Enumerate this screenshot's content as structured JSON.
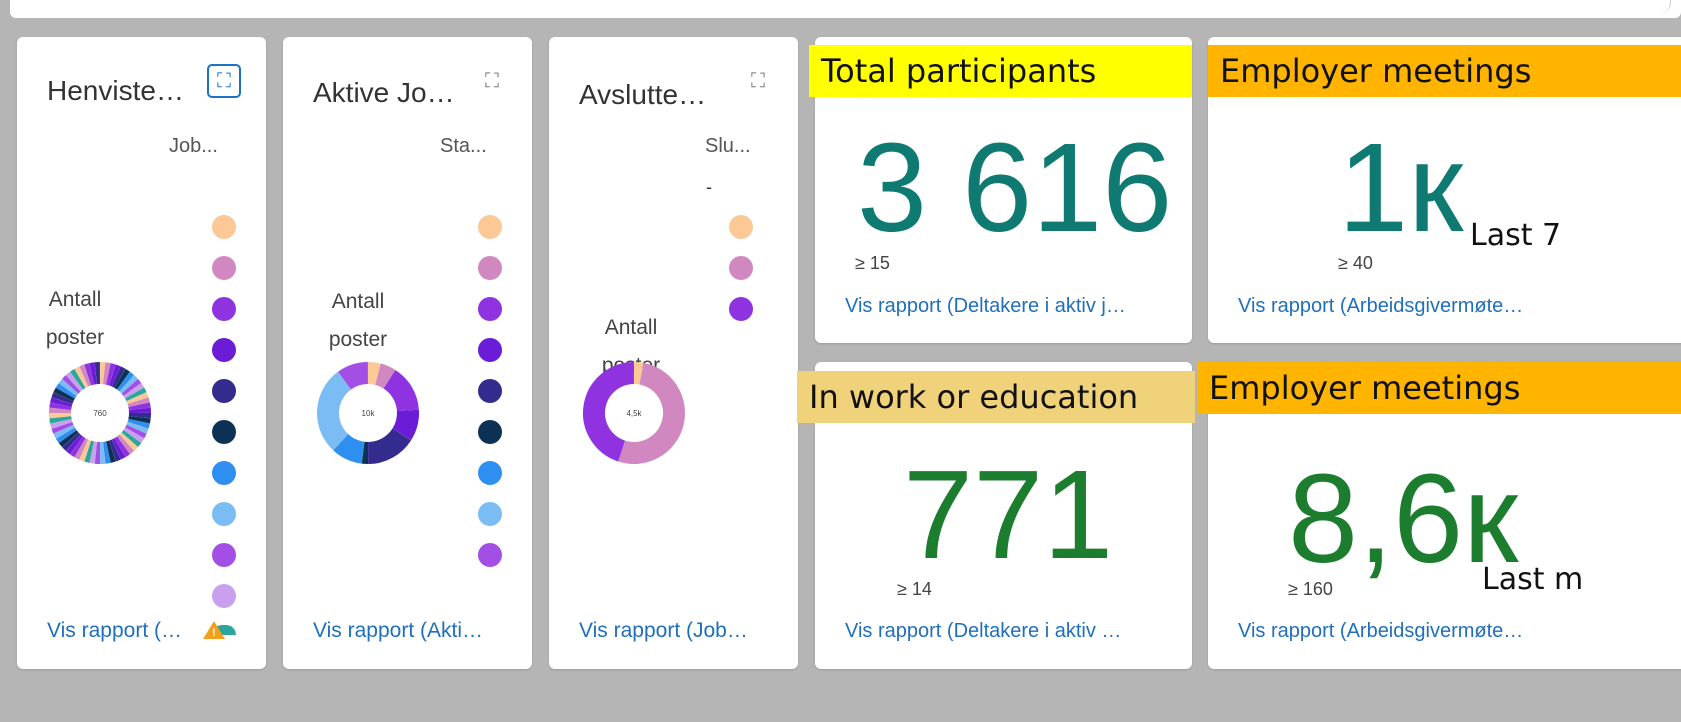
{
  "colors": {
    "kpi_teal": "#0f7a72",
    "kpi_green": "#1d7d2e",
    "link_blue": "#1f6fbf",
    "tag_yellow": "#ffff00",
    "tag_orange": "#ffb400",
    "tag_khaki": "#f0d27a",
    "warning": "#f2a01e"
  },
  "donut_cards": [
    {
      "title": "Henviste…",
      "legend_header": "Job...",
      "center_label_line1": "Antall",
      "center_label_line2": "poster",
      "donut_value": "760",
      "link": "Vis rapport (…",
      "expand_icon": "expand-icon",
      "has_warning": true,
      "legend_colors": [
        "#fbc896",
        "#d187c0",
        "#8f33e0",
        "#6a1cd6",
        "#332b8e",
        "#0d3154",
        "#2e8ff0",
        "#7bbcf5",
        "#a34fe5",
        "#c9a0ee",
        "#2aa69a"
      ]
    },
    {
      "title": "Aktive Jo…",
      "legend_header": "Sta...",
      "center_label_line1": "Antall",
      "center_label_line2": "poster",
      "donut_value": "10k",
      "link": "Vis rapport (Akti…",
      "expand_icon": "expand-icon",
      "has_warning": false,
      "legend_colors": [
        "#fbc896",
        "#d187c0",
        "#8f33e0",
        "#6a1cd6",
        "#332b8e",
        "#0d3154",
        "#2e8ff0",
        "#7bbcf5",
        "#a34fe5"
      ]
    },
    {
      "title": "Avslutte…",
      "legend_header": "Slu...",
      "legend_first_label": "-",
      "center_label_line1": "Antall",
      "center_label_line2": "poster",
      "donut_value": "4,5k",
      "link": "Vis rapport (Job…",
      "expand_icon": "expand-icon",
      "has_warning": false,
      "legend_colors": [
        "#fbc896",
        "#d187c0",
        "#8f33e0"
      ]
    }
  ],
  "kpi_cards": [
    {
      "value": "3 616",
      "threshold": "≥ 15",
      "link": "Vis rapport (Deltakere i aktiv j…",
      "tag": "Total participants"
    },
    {
      "value": "1к",
      "threshold": "≥ 40",
      "link": "Vis rapport (Arbeidsgivermøte…",
      "tag": "Employer meetings",
      "note": "Last 7"
    },
    {
      "value": "771",
      "threshold": "≥ 14",
      "link": "Vis rapport (Deltakere i aktiv …",
      "tag": "In work or education"
    },
    {
      "value": "8,6к",
      "threshold": "≥ 160",
      "link": "Vis rapport (Arbeidsgivermøte…",
      "tag": "Employer meetings",
      "note": "Last m"
    }
  ]
}
